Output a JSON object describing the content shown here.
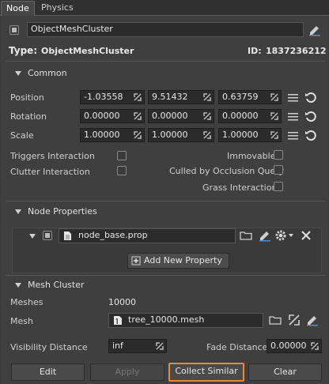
{
  "tabs": [
    {
      "label": "Node",
      "active": true
    },
    {
      "label": "Physics",
      "active": false
    }
  ],
  "node": {
    "name_value": "ObjectMeshCluster",
    "type_label": "Type:",
    "type_value": "ObjectMeshCluster",
    "id_label": "ID:",
    "id_value": "1837236212"
  },
  "common": {
    "section_title": "Common",
    "position": {
      "label": "Position",
      "x": "-1.03558",
      "y": "9.51432",
      "z": "0.63759"
    },
    "rotation": {
      "label": "Rotation",
      "x": "0.00000",
      "y": "0.00000",
      "z": "0.00000"
    },
    "scale": {
      "label": "Scale",
      "x": "1.00000",
      "y": "1.00000",
      "z": "1.00000"
    },
    "flags_left": [
      {
        "label": "Triggers Interaction",
        "checked": false
      },
      {
        "label": "Clutter Interaction",
        "checked": false
      }
    ],
    "flags_right": [
      {
        "label": "Immovable",
        "checked": false
      },
      {
        "label": "Culled by Occlusion Query",
        "checked": false
      },
      {
        "label": "Grass Interaction",
        "checked": false
      }
    ]
  },
  "node_properties": {
    "section_title": "Node Properties",
    "property_file": "node_base.prop",
    "add_button": "Add New Property"
  },
  "mesh_cluster": {
    "section_title": "Mesh Cluster",
    "meshes_label": "Meshes",
    "meshes_value": "10000",
    "mesh_label": "Mesh",
    "mesh_file": "tree_10000.mesh",
    "visibility_label": "Visibility Distance",
    "visibility_value": "inf",
    "fade_label": "Fade Distance",
    "fade_value": "0.00000"
  },
  "buttons": {
    "edit": "Edit",
    "apply": "Apply",
    "collect": "Collect Similar",
    "clear": "Clear"
  },
  "colors": {
    "accent_orange": "#e68a33",
    "link_blue": "#4a90d9"
  }
}
